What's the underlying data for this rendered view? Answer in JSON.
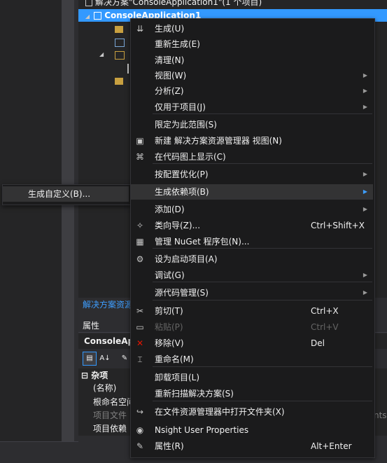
{
  "solution_explorer": {
    "solution_label": "解决方案\"ConsoleApplication1\"(1 个项目)",
    "project_label": "ConsoleApplication1",
    "tab_label": "解决方案资源"
  },
  "properties": {
    "title": "属性",
    "object_name": "ConsoleAp",
    "toolbar_icons": [
      "categorized-icon",
      "alphabetical-icon",
      "wrench-icon"
    ],
    "category": "杂项",
    "rows": [
      "(名称)",
      "根命名空间",
      "项目文件",
      "项目依赖"
    ],
    "partial_right_text": "nts"
  },
  "menu": {
    "items": [
      {
        "label": "生成(U)",
        "icon": "build-icon"
      },
      {
        "label": "重新生成(E)"
      },
      {
        "label": "清理(N)"
      },
      {
        "label": "视图(W)",
        "submenu": true
      },
      {
        "label": "分析(Z)",
        "submenu": true
      },
      {
        "label": "仅用于项目(J)",
        "submenu": true
      },
      {
        "label": "限定为此范围(S)"
      },
      {
        "label": "新建 解决方案资源管理器 视图(N)",
        "icon": "new-view-icon"
      },
      {
        "label": "在代码图上显示(C)",
        "icon": "code-map-icon"
      },
      {
        "label": "按配置优化(P)",
        "submenu": true
      },
      {
        "label": "生成依赖项(B)",
        "submenu": true,
        "hover": true
      },
      {
        "label": "添加(D)",
        "submenu": true
      },
      {
        "label": "类向导(Z)...",
        "shortcut": "Ctrl+Shift+X",
        "icon": "class-wizard-icon"
      },
      {
        "label": "管理 NuGet 程序包(N)...",
        "icon": "nuget-icon"
      },
      {
        "label": "设为启动项目(A)",
        "icon": "gear-icon"
      },
      {
        "label": "调试(G)",
        "submenu": true
      },
      {
        "label": "源代码管理(S)",
        "submenu": true
      },
      {
        "label": "剪切(T)",
        "shortcut": "Ctrl+X",
        "icon": "cut-icon"
      },
      {
        "label": "粘贴(P)",
        "shortcut": "Ctrl+V",
        "icon": "paste-icon",
        "disabled": true
      },
      {
        "label": "移除(V)",
        "shortcut": "Del",
        "icon": "remove-icon"
      },
      {
        "label": "重命名(M)",
        "icon": "rename-icon"
      },
      {
        "label": "卸载项目(L)"
      },
      {
        "label": "重新扫描解决方案(S)"
      },
      {
        "label": "在文件资源管理器中打开文件夹(X)",
        "icon": "open-folder-icon"
      },
      {
        "label": "Nsight User Properties",
        "icon": "nsight-icon"
      },
      {
        "label": "属性(R)",
        "shortcut": "Alt+Enter",
        "icon": "wrench-icon"
      }
    ]
  },
  "submenu": {
    "label": "生成自定义(B)..."
  },
  "colors": {
    "accent": "#3399ff",
    "menu_bg": "#1b1b1c",
    "hover_bg": "#333334",
    "disabled": "#656565"
  }
}
